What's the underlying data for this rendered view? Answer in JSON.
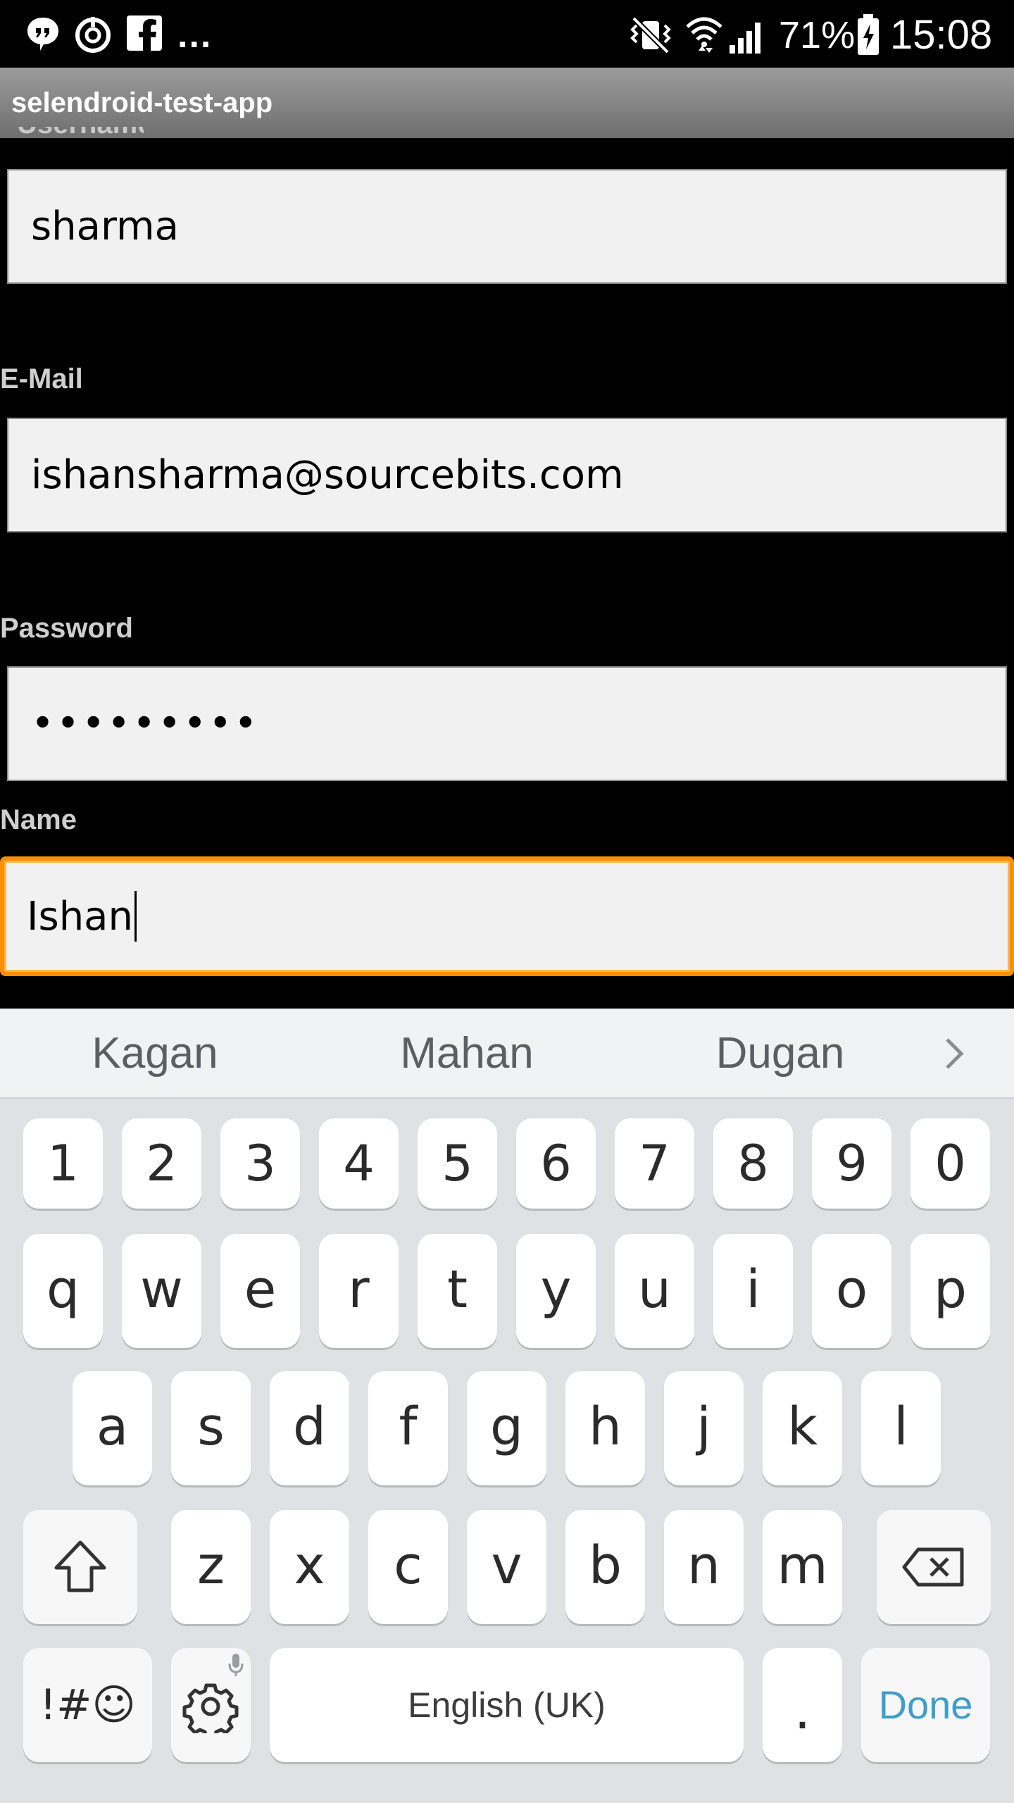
{
  "status_bar": {
    "notification_icons": [
      "chat-bubble-icon",
      "sync-icon",
      "facebook-icon"
    ],
    "more_indicator": "...",
    "system_icons": [
      "vibrate-mute-icon",
      "wifi-icon",
      "signal-icon",
      "battery-charging-icon"
    ],
    "battery_percent": "71%",
    "time": "15:08"
  },
  "app_bar": {
    "title": "selendroid-test-app"
  },
  "form": {
    "username_value": "sharma",
    "email_label": "E-Mail",
    "email_value": "ishansharma@sourcebits.com",
    "password_label": "Password",
    "password_value": "•••••••••",
    "name_label": "Name",
    "name_value": "Ishan"
  },
  "keyboard": {
    "suggestions": [
      "Kagan",
      "Mahan",
      "Dugan"
    ],
    "digit_row": [
      "1",
      "2",
      "3",
      "4",
      "5",
      "6",
      "7",
      "8",
      "9",
      "0"
    ],
    "row1": [
      "q",
      "w",
      "e",
      "r",
      "t",
      "y",
      "u",
      "i",
      "o",
      "p"
    ],
    "row2": [
      "a",
      "s",
      "d",
      "f",
      "g",
      "h",
      "j",
      "k",
      "l"
    ],
    "row3": [
      "z",
      "x",
      "c",
      "v",
      "b",
      "n",
      "m"
    ],
    "symbols_label": "!#☺",
    "space_label": "English (UK)",
    "period_label": ".",
    "done_label": "Done"
  }
}
